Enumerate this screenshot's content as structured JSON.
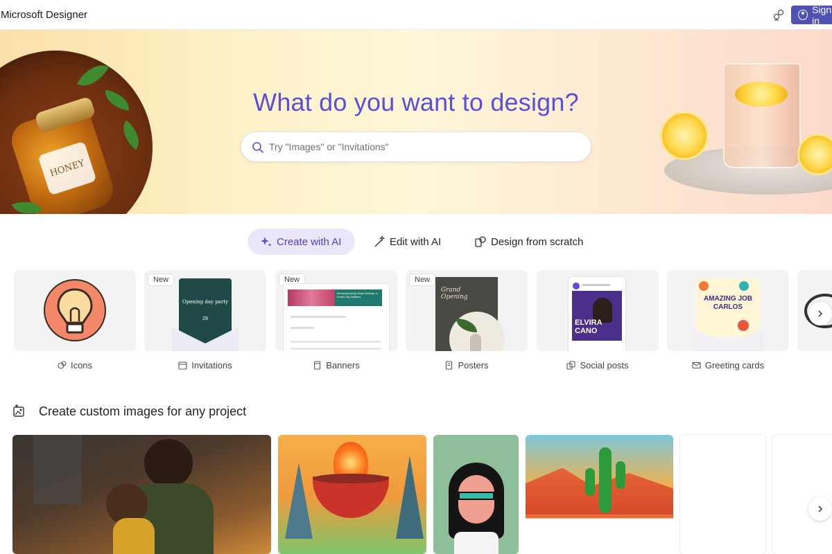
{
  "header": {
    "app_title": "Microsoft Designer",
    "sign_in_label": "Sign in"
  },
  "hero": {
    "title": "What do you want to design?",
    "search_placeholder": "Try \"Images\" or \"Invitations\"",
    "honey_label": "HONEY"
  },
  "modes": [
    {
      "label": "Create with AI",
      "icon": "sparkle-icon",
      "active": true
    },
    {
      "label": "Edit with AI",
      "icon": "magic-wand-icon",
      "active": false
    },
    {
      "label": "Design from scratch",
      "icon": "shapes-icon",
      "active": false
    }
  ],
  "categories": [
    {
      "label": "Icons",
      "icon": "icons-icon",
      "badge": ""
    },
    {
      "label": "Invitations",
      "icon": "calendar-icon",
      "badge": "New",
      "preview_title": "Opening day party",
      "preview_day": "29"
    },
    {
      "label": "Banners",
      "icon": "banner-icon",
      "badge": "New",
      "preview_title": "Revolutionizing Urban Mobility: A Smart City Initiative"
    },
    {
      "label": "Posters",
      "icon": "poster-icon",
      "badge": "New",
      "preview_title": "Grand Opening"
    },
    {
      "label": "Social posts",
      "icon": "social-icon",
      "badge": "",
      "preview_title": "ELVIRA CANO"
    },
    {
      "label": "Greeting cards",
      "icon": "mail-icon",
      "badge": "",
      "preview_title": "AMAZING JOB CARLOS"
    }
  ],
  "section": {
    "title": "Create custom images for any project"
  },
  "colors": {
    "accent": "#5b4fd6",
    "signin": "#4f52b2",
    "active_tab_bg": "#ebe7fb"
  }
}
